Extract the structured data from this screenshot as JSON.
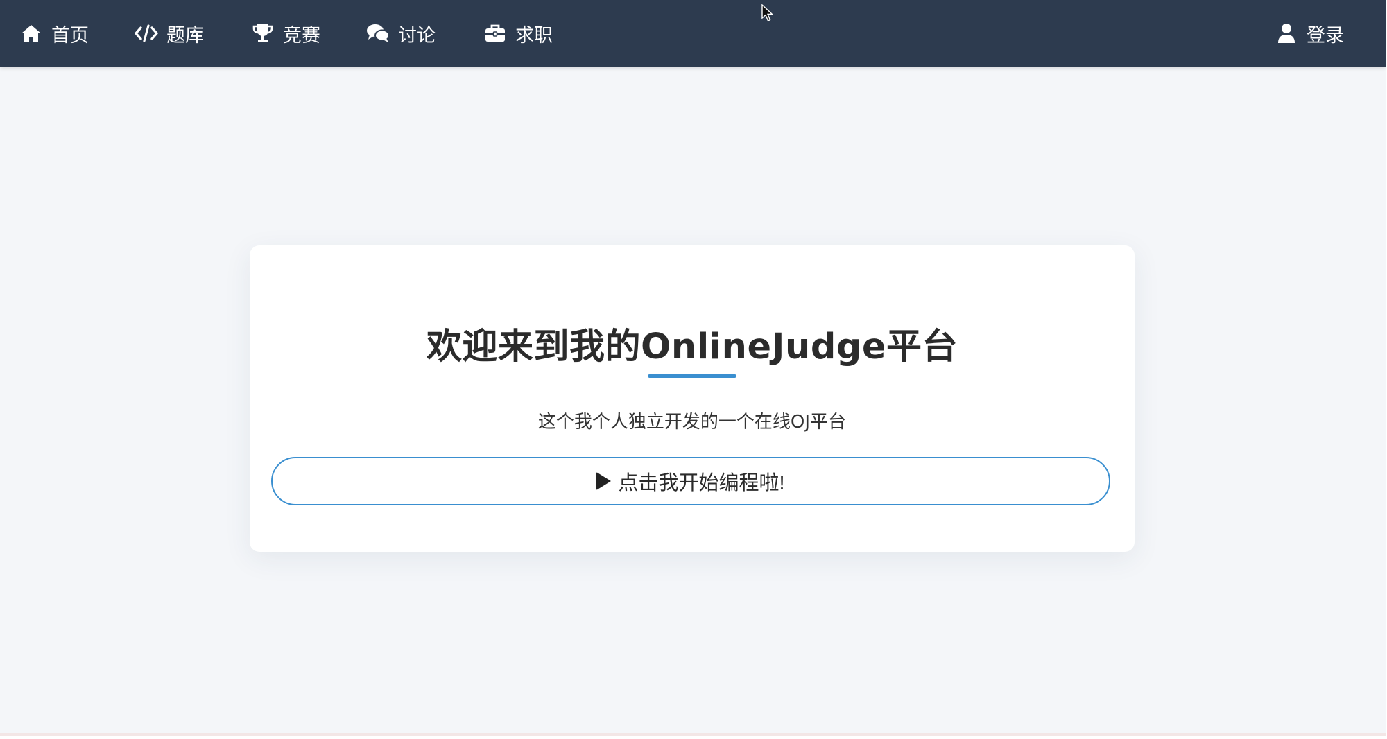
{
  "navbar": {
    "background": "#2d3b4f",
    "items": [
      {
        "label": "首页",
        "icon": "home-icon"
      },
      {
        "label": "题库",
        "icon": "code-icon"
      },
      {
        "label": "竞赛",
        "icon": "trophy-icon"
      },
      {
        "label": "讨论",
        "icon": "comments-icon"
      },
      {
        "label": "求职",
        "icon": "briefcase-icon"
      }
    ],
    "login": {
      "label": "登录",
      "icon": "user-icon"
    }
  },
  "card": {
    "title": "欢迎来到我的OnlineJudge平台",
    "subtitle": "这个我个人独立开发的一个在线OJ平台",
    "button_label": "点击我开始编程啦!",
    "button_icon": "play-icon",
    "accent_color": "#3a8fd0"
  }
}
